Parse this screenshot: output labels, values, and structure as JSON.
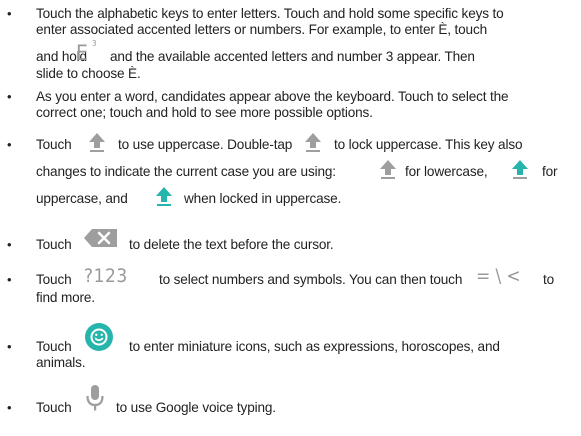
{
  "bullet_glyph": "•",
  "items": [
    {
      "lines": [
        "Touch the alphabetic keys to enter letters. Touch and hold some specific keys to",
        "enter associated accented letters or numbers. For example, to enter È, touch"
      ],
      "line3_pre": "and hold",
      "key_letter": "E",
      "key_superscript": "3",
      "line3_post": "and the available accented letters and number 3 appear. Then",
      "line4": "slide to choose È."
    },
    {
      "lines": [
        "As you enter a word, candidates appear above the keyboard. Touch to select the",
        "correct one; touch and hold to see more possible options."
      ]
    },
    {
      "l1_a": "Touch",
      "l1_b": "to use uppercase. Double-tap",
      "l1_c": "to lock uppercase. This key also",
      "l2_a": "changes to indicate the current case you are using:",
      "l2_b": "for lowercase,",
      "l2_c": "for",
      "l3_a": "uppercase, and",
      "l3_b": "when locked in uppercase."
    },
    {
      "a": "Touch",
      "b": "to delete the text before the cursor."
    },
    {
      "a": "Touch",
      "key_label": "?123",
      "b": "to select numbers and symbols. You can then touch",
      "key2_label": "= \\ <",
      "c": "to",
      "line2": "find more."
    },
    {
      "a": "Touch",
      "b": "to enter miniature icons, such as expressions, horoscopes, and",
      "line2": "animals."
    },
    {
      "a": "Touch",
      "b": "to use Google voice typing."
    }
  ],
  "icons": {
    "shift": "shift-arrow-icon",
    "delete": "backspace-icon",
    "emoji": "smiley-icon",
    "mic": "microphone-icon"
  },
  "colors": {
    "text": "#222222",
    "icon_grey": "#9e9e9e",
    "icon_teal": "#26b5ad",
    "key_grey": "#999999"
  }
}
